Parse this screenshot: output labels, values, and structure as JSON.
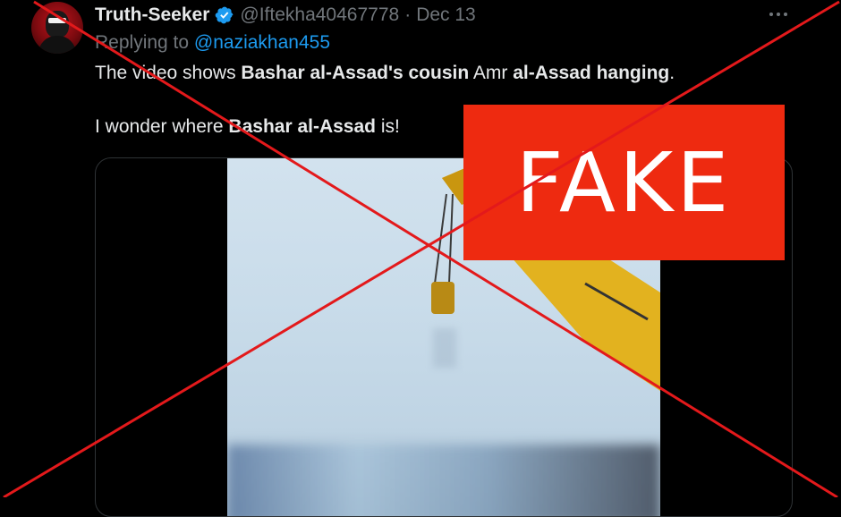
{
  "tweet": {
    "display_name": "Truth-Seeker",
    "verified": true,
    "handle": "@Iftekha40467778",
    "separator": "·",
    "date": "Dec 13",
    "reply_prefix": "Replying to",
    "reply_mention": "@naziakhan455",
    "line1": {
      "t1": "The video shows ",
      "b1": "Bashar al-Assad's cousin",
      "t2": " Amr ",
      "b2": "al-Assad hanging",
      "t3": "."
    },
    "line2": {
      "t1": "I wonder where ",
      "b1": "Bashar al-Assad",
      "t2": " is!"
    },
    "more_icon": "more-horizontal-icon"
  },
  "overlay": {
    "stamp_label": "FAKE",
    "stamp_color": "#ee2a10",
    "cross_color": "#e3191b"
  },
  "colors": {
    "background": "#000000",
    "text": "#e7e9ea",
    "muted": "#71767b",
    "link": "#1d9bf0",
    "verified_badge": "#1d9bf0"
  }
}
